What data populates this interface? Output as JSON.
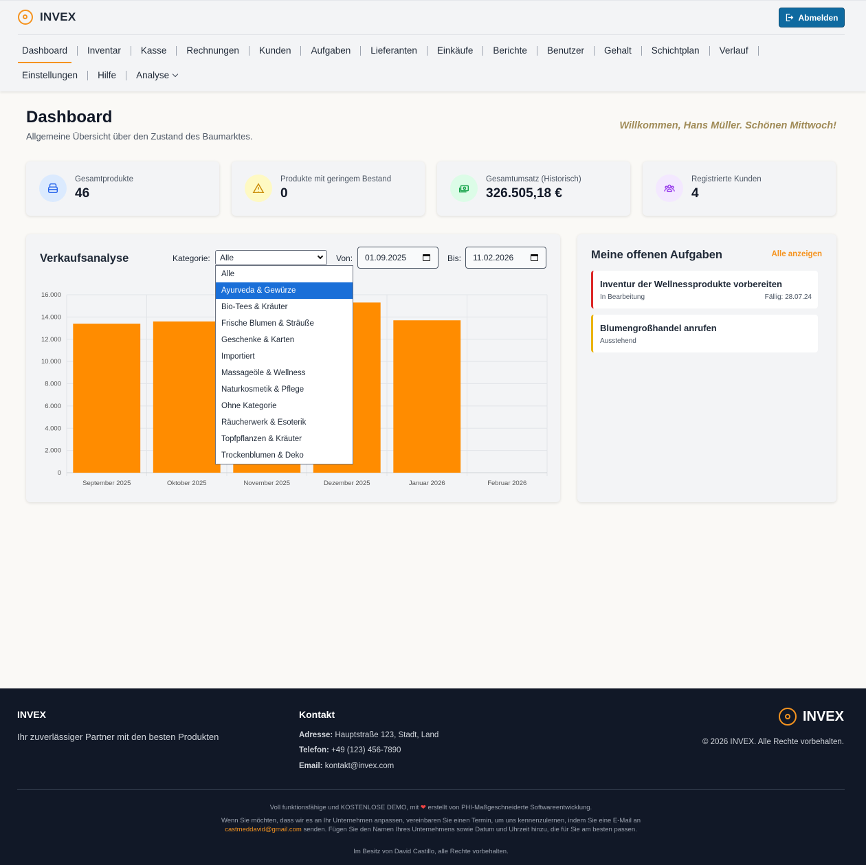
{
  "header": {
    "brand": "INVEX",
    "logout_label": "Abmelden",
    "nav_row1": [
      "Dashboard",
      "Inventar",
      "Kasse",
      "Rechnungen",
      "Kunden",
      "Aufgaben",
      "Lieferanten",
      "Einkäufe",
      "Berichte",
      "Benutzer",
      "Gehalt",
      "Schichtplan",
      "Verlauf"
    ],
    "nav_row2": [
      "Einstellungen",
      "Hilfe",
      "Analyse"
    ],
    "active": "Dashboard"
  },
  "page": {
    "title": "Dashboard",
    "subtitle": "Allgemeine Übersicht über den Zustand des Baumarktes.",
    "welcome": "Willkommen, Hans Müller. Schönen Mittwoch!"
  },
  "stats": [
    {
      "label": "Gesamtprodukte",
      "value": "46",
      "icon": "box-icon",
      "color": "#2563eb",
      "bg": "#dbeafe"
    },
    {
      "label": "Produkte mit geringem Bestand",
      "value": "0",
      "icon": "warning-icon",
      "color": "#ca8a04",
      "bg": "#fef9c3"
    },
    {
      "label": "Gesamtumsatz (Historisch)",
      "value": "326.505,18 €",
      "icon": "cash-icon",
      "color": "#16a34a",
      "bg": "#dcfce7"
    },
    {
      "label": "Registrierte Kunden",
      "value": "4",
      "icon": "users-icon",
      "color": "#9333ea",
      "bg": "#f3e8ff"
    }
  ],
  "sales": {
    "title": "Verkaufsanalyse",
    "category_label": "Kategorie:",
    "category_value": "Alle",
    "from_label": "Von:",
    "from_value": "01.09.2025",
    "to_label": "Bis:",
    "to_value": "11.02.2026",
    "dropdown_options": [
      "Alle",
      "Ayurveda & Gewürze",
      "Bio-Tees & Kräuter",
      "Frische Blumen & Sträuße",
      "Geschenke & Karten",
      "Importiert",
      "Massageöle & Wellness",
      "Naturkosmetik & Pflege",
      "Ohne Kategorie",
      "Räucherwerk & Esoterik",
      "Topfpflanzen & Kräuter",
      "Trockenblumen & Deko"
    ],
    "highlighted_option": "Ayurveda & Gewürze"
  },
  "chart_data": {
    "type": "bar",
    "categories": [
      "September 2025",
      "Oktober 2025",
      "November 2025",
      "Dezember 2025",
      "Januar 2026",
      "Februar 2026"
    ],
    "values": [
      13400,
      13600,
      14000,
      15300,
      13700,
      0
    ],
    "ylim": [
      0,
      16000
    ],
    "yticks": [
      "0",
      "2.000",
      "4.000",
      "6.000",
      "8.000",
      "10.000",
      "12.000",
      "14.000",
      "16.000"
    ],
    "bar_color": "#ff8c00",
    "grid": true
  },
  "tasks": {
    "title": "Meine offenen Aufgaben",
    "link": "Alle anzeigen",
    "items": [
      {
        "title": "Inventur der Wellnessprodukte vorbereiten",
        "status": "In Bearbeitung",
        "due": "Fällig: 28.07.24",
        "color": "#dc2626"
      },
      {
        "title": "Blumengroßhandel anrufen",
        "status": "Ausstehend",
        "due": "",
        "color": "#eab308"
      }
    ]
  },
  "footer": {
    "brand": "INVEX",
    "tagline": "Ihr zuverlässiger Partner mit den besten Produkten",
    "contact_title": "Kontakt",
    "address_label": "Adresse:",
    "address": "Hauptstraße 123, Stadt, Land",
    "phone_label": "Telefon:",
    "phone": "+49 (123) 456-7890",
    "email_label": "Email:",
    "email": "kontakt@invex.com",
    "logo_name": "INVEX",
    "copyright": "© 2026 INVEX. Alle Rechte vorbehalten.",
    "demo_a": "Voll funktionsfähige und KOSTENLOSE DEMO, mit",
    "demo_b": "erstellt von PHI-Maßgeschneiderte Softwareentwicklung.",
    "contact_a": "Wenn Sie möchten, dass wir es an Ihr Unternehmen anpassen, vereinbaren Sie einen Termin, um uns kennenzulernen, indem Sie eine E-Mail an",
    "contact_email": "castmeddavid@gmail.com",
    "contact_b": "senden. Fügen Sie den Namen Ihres Unternehmens sowie Datum und Uhrzeit hinzu, die für Sie am besten passen.",
    "owner": "Im Besitz von David Castillo, alle Rechte vorbehalten."
  }
}
